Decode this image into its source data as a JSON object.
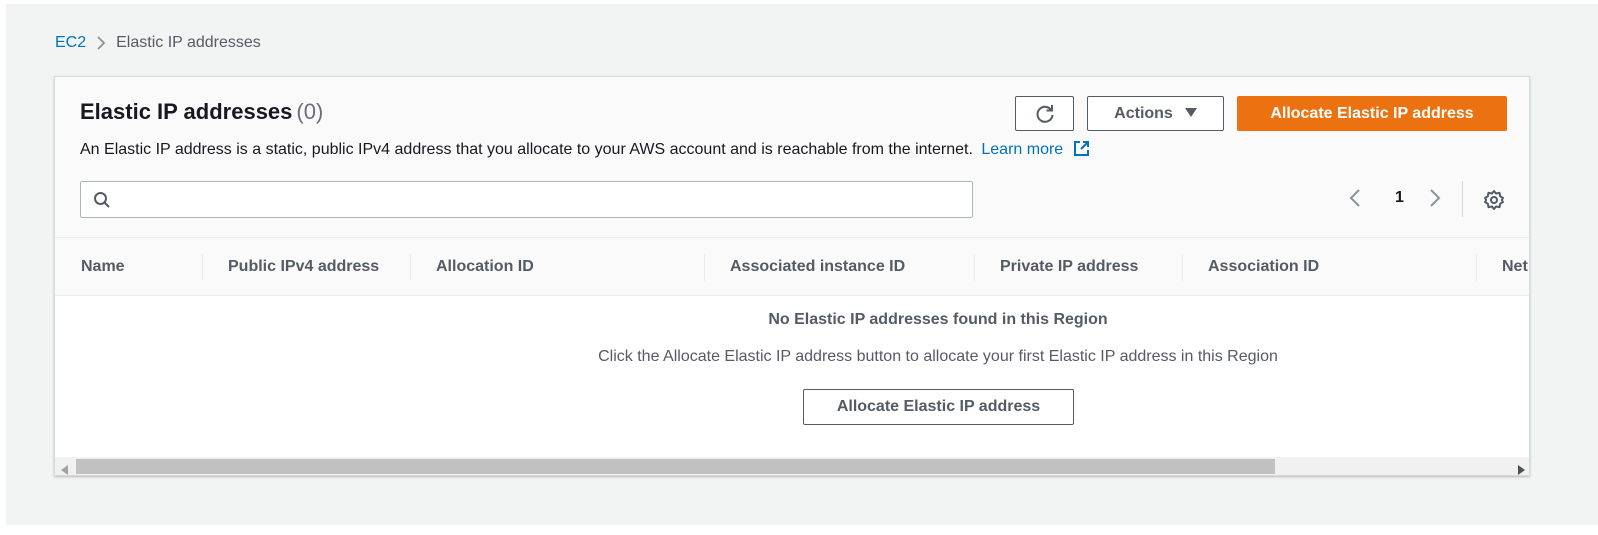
{
  "breadcrumb": {
    "root": "EC2",
    "current": "Elastic IP addresses"
  },
  "header": {
    "title": "Elastic IP addresses",
    "count": "(0)",
    "description": "An Elastic IP address is a static, public IPv4 address that you allocate to your AWS account and is reachable from the internet.",
    "learn_more": "Learn more"
  },
  "toolbar": {
    "refresh_icon": "refresh-icon",
    "actions_label": "Actions",
    "allocate_label": "Allocate Elastic IP address"
  },
  "search": {
    "placeholder": "",
    "value": ""
  },
  "pagination": {
    "current_page": "1"
  },
  "table": {
    "columns": [
      "Name",
      "Public IPv4 address",
      "Allocation ID",
      "Associated instance ID",
      "Private IP address",
      "Association ID",
      "Net"
    ],
    "rows": []
  },
  "empty_state": {
    "title": "No Elastic IP addresses found in this Region",
    "description": "Click the Allocate Elastic IP address button to allocate your first Elastic IP address in this Region",
    "button_label": "Allocate Elastic IP address"
  },
  "colors": {
    "primary": "#ec7211",
    "link": "#0073bb",
    "text": "#16191f",
    "muted": "#545b64"
  }
}
